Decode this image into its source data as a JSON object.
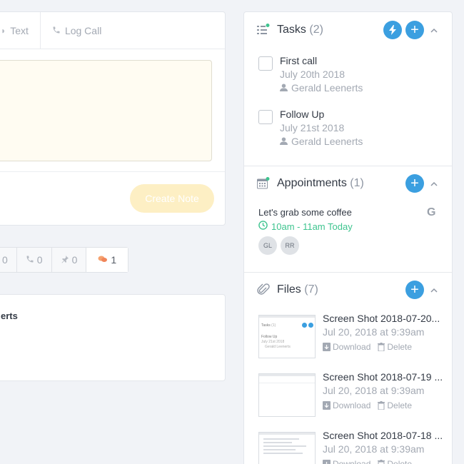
{
  "composer": {
    "tabs": [
      {
        "label": "Text",
        "icon": "chat-icon"
      },
      {
        "label": "Log Call",
        "icon": "phone-icon"
      }
    ],
    "create_note_label": "Create Note"
  },
  "filters": [
    {
      "icon": "email-icon",
      "count": "0"
    },
    {
      "icon": "phone-icon",
      "count": "0"
    },
    {
      "icon": "pin-icon",
      "count": "0"
    },
    {
      "icon": "chat-icon",
      "count": "1"
    }
  ],
  "activity": {
    "name_fragment": "erts"
  },
  "tasks": {
    "title": "Tasks",
    "count": "(2)",
    "items": [
      {
        "title": "First call",
        "date": "July 20th 2018",
        "owner": "Gerald Leenerts"
      },
      {
        "title": "Follow Up",
        "date": "July 21st 2018",
        "owner": "Gerald Leenerts"
      }
    ]
  },
  "appointments": {
    "title": "Appointments",
    "count": "(1)",
    "item": {
      "title": "Let's grab some coffee",
      "time": "10am - 11am Today",
      "calendar": "G"
    },
    "attendees": [
      "GL",
      "RR"
    ]
  },
  "files": {
    "title": "Files",
    "count": "(7)",
    "download_label": "Download",
    "delete_label": "Delete",
    "items": [
      {
        "name": "Screen Shot 2018-07-20...",
        "date": "Jul 20, 2018 at 9:39am"
      },
      {
        "name": "Screen Shot 2018-07-19 ...",
        "date": "Jul 20, 2018 at 9:39am"
      },
      {
        "name": "Screen Shot 2018-07-18 ...",
        "date": "Jul 20, 2018 at 9:39am"
      }
    ],
    "thumb_preview": {
      "title": "Tasks",
      "count": "(1)",
      "task": "Follow Up",
      "date": "July 21st 2018",
      "owner": "Gerald Leenerts"
    }
  },
  "colors": {
    "accent": "#3b9fe0",
    "green": "#3ec48f",
    "note_bg": "#fffcf2",
    "create_btn": "#fdefc4"
  }
}
